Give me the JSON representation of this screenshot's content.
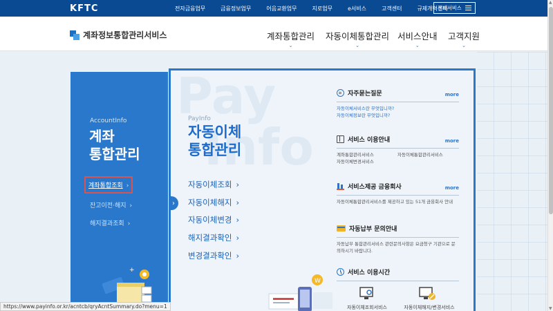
{
  "topbar": {
    "logo": "KFTC",
    "menu": [
      "전자금융업무",
      "금융정보업무",
      "어음교환업무",
      "지로업무",
      "e서비스",
      "고객센터",
      "규제개혁센터"
    ],
    "all_services": "전체서비스"
  },
  "header": {
    "brand": "계좌정보통합관리서비스",
    "gnb": [
      "계좌통합관리",
      "자동이체통합관리",
      "서비스안내",
      "고객지원"
    ]
  },
  "lnb": {
    "en": "AccountInfo",
    "title_line1": "계좌",
    "title_line2": "통합관리",
    "items": [
      "계좌통합조회",
      "잔고이전·해지",
      "해지결과조회"
    ]
  },
  "main": {
    "watermark_line1": "Pay",
    "watermark_line2": "Info",
    "en": "PayInfo",
    "title_line1": "자동이체",
    "title_line2": "통합관리",
    "links": [
      "자동이체조회",
      "자동이체해지",
      "자동이체변경",
      "해지결과확인",
      "변경결과확인"
    ]
  },
  "right": {
    "faq": {
      "title": "자주묻는질문",
      "more": "more",
      "items": [
        "자동이체서비스란 무엇입니까?",
        "자동이체정보란 무엇입니까?"
      ]
    },
    "guide": {
      "title": "서비스 이용안내",
      "more": "more",
      "items": [
        "계좌통합관리서비스",
        "자동이체통합관리서비스",
        "자동이체변경서비스"
      ]
    },
    "providers": {
      "title": "서비스제공 금융회사",
      "more": "more",
      "text": "자동이체통합관리서비스를 제공하고 있는 51개 금융회사 안내"
    },
    "billing": {
      "title": "자동납부 문의안내",
      "text": "자동납부 통합관리서비스 관련문의사항은 요금청구 기관으로 문의하시기 바랍니다."
    },
    "hours": {
      "title": "서비스 이용시간",
      "icon_labels": [
        "자동이체조회서비스",
        "자동이체해지/변경서비스"
      ]
    }
  },
  "status_url": "https://www.payinfo.or.kr/acntcb/qryAcntSummary.do?menu=1",
  "colors": {
    "topbar": "#0a4a92",
    "lnb": "#2a78cc",
    "accent": "#1d6ccc",
    "active_border": "#d9534f"
  }
}
